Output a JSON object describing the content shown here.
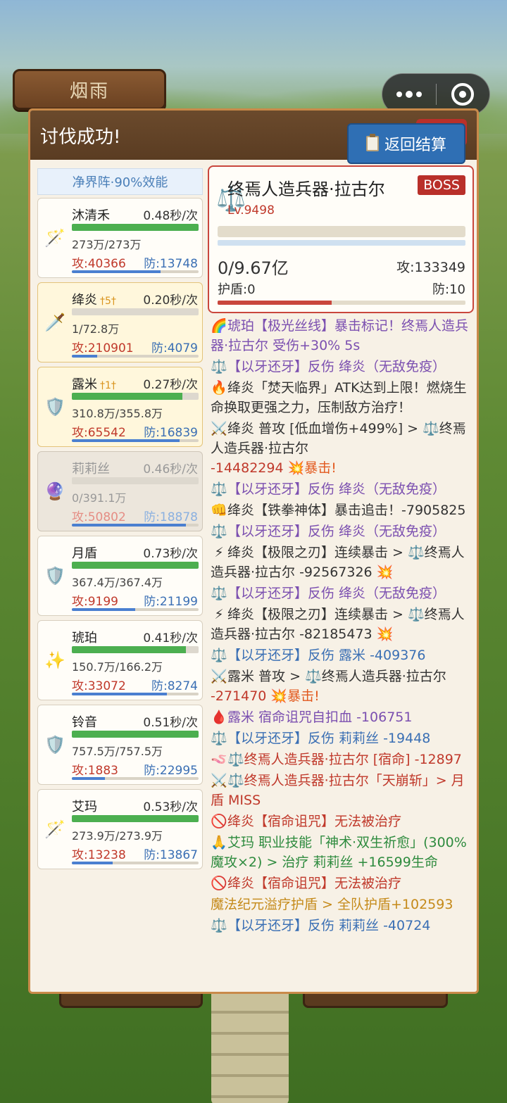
{
  "background": {
    "guild_label": "烟雨"
  },
  "capsule": {
    "more_icon": "more-dots-icon",
    "close_icon": "target-close-icon"
  },
  "panel": {
    "title": "讨伐成功!",
    "return_button": "返回结算",
    "formation": "净界阵·90%效能"
  },
  "heroes": [
    {
      "name": "沐清禾",
      "stars": "",
      "speed": "0.48秒/次",
      "hp": "273万/273万",
      "hp_fraction": 1.0,
      "atk": "攻:40366",
      "def": "防:13748",
      "def_fraction": 0.7,
      "icon": "staff-icon",
      "state": "normal"
    },
    {
      "name": "绛炎",
      "stars": "†5†",
      "speed": "0.20秒/次",
      "hp": "1/72.8万",
      "hp_fraction": 0.0,
      "atk": "攻:210901",
      "def": "防:4079",
      "def_fraction": 0.2,
      "icon": "sword-icon",
      "state": "active"
    },
    {
      "name": "露米",
      "stars": "†1†",
      "speed": "0.27秒/次",
      "hp": "310.8万/355.8万",
      "hp_fraction": 0.87,
      "atk": "攻:65542",
      "def": "防:16839",
      "def_fraction": 0.85,
      "icon": "shield-icon",
      "state": "active"
    },
    {
      "name": "莉莉丝",
      "stars": "",
      "speed": "0.46秒/次",
      "hp": "0/391.1万",
      "hp_fraction": 0.0,
      "atk": "攻:50802",
      "def": "防:18878",
      "def_fraction": 0.9,
      "icon": "orb-icon",
      "state": "dead"
    },
    {
      "name": "月盾",
      "stars": "",
      "speed": "0.73秒/次",
      "hp": "367.4万/367.4万",
      "hp_fraction": 1.0,
      "atk": "攻:9199",
      "def": "防:21199",
      "def_fraction": 0.5,
      "icon": "shield-icon",
      "state": "normal"
    },
    {
      "name": "琥珀",
      "stars": "",
      "speed": "0.41秒/次",
      "hp": "150.7万/166.2万",
      "hp_fraction": 0.9,
      "atk": "攻:33072",
      "def": "防:8274",
      "def_fraction": 0.75,
      "icon": "wand-icon",
      "state": "normal"
    },
    {
      "name": "铃音",
      "stars": "",
      "speed": "0.51秒/次",
      "hp": "757.5万/757.5万",
      "hp_fraction": 1.0,
      "atk": "攻:1883",
      "def": "防:22995",
      "def_fraction": 0.26,
      "icon": "shield-icon",
      "state": "normal"
    },
    {
      "name": "艾玛",
      "stars": "",
      "speed": "0.53秒/次",
      "hp": "273.9万/273.9万",
      "hp_fraction": 1.0,
      "atk": "攻:13238",
      "def": "防:13867",
      "def_fraction": 0.32,
      "icon": "staff-icon",
      "state": "normal"
    }
  ],
  "boss": {
    "name": "终焉人造兵器·拉古尔",
    "badge": "BOSS",
    "level": "Lv.9498",
    "hp": "0/9.67亿",
    "atk": "攻:133349",
    "shield": "护盾:0",
    "def": "防:10"
  },
  "log": [
    {
      "icon": "🌈",
      "color": "c-purple",
      "text": "琥珀【极光丝线】暴击标记！终焉人造兵器·拉古尔 受伤+30% 5s"
    },
    {
      "icon": "⚖️",
      "color": "c-purple",
      "text": "【以牙还牙】反伤 绛炎（无敌免疫）"
    },
    {
      "icon": "🔥",
      "color": "c-gray",
      "text": "绛炎「焚天临界」ATK达到上限！燃烧生命换取更强之力，压制敌方治疗！"
    },
    {
      "icon": "⚔️",
      "color": "c-gray",
      "text": "绛炎 普攻 [低血增伤+499%] > ⚖️终焉人造兵器·拉古尔",
      "dmg": "-14482294",
      "crit": "💥暴击!"
    },
    {
      "icon": "⚖️",
      "color": "c-purple",
      "text": "【以牙还牙】反伤 绛炎（无敌免疫）"
    },
    {
      "icon": "👊",
      "color": "c-gray",
      "text": "绛炎【铁拳神体】暴击追击！-7905825"
    },
    {
      "icon": "⚖️",
      "color": "c-purple",
      "text": "【以牙还牙】反伤 绛炎（无敌免疫）"
    },
    {
      "icon": "⚡",
      "color": "c-gray",
      "text": "绛炎【极限之刃】连续暴击 > ⚖️终焉人造兵器·拉古尔 -92567326 💥"
    },
    {
      "icon": "⚖️",
      "color": "c-purple",
      "text": "【以牙还牙】反伤 绛炎（无敌免疫）"
    },
    {
      "icon": "⚡",
      "color": "c-gray",
      "text": "绛炎【极限之刃】连续暴击 > ⚖️终焉人造兵器·拉古尔 -82185473 💥"
    },
    {
      "icon": "⚖️",
      "color": "c-blue",
      "text": "【以牙还牙】反伤 露米 -409376"
    },
    {
      "icon": "⚔️",
      "color": "c-gray",
      "text": "露米 普攻 > ⚖️终焉人造兵器·拉古尔",
      "dmg": "-271470",
      "crit": "💥暴击!"
    },
    {
      "icon": "🩸",
      "color": "c-purple",
      "text": "露米 宿命诅咒自扣血 -106751"
    },
    {
      "icon": "⚖️",
      "color": "c-blue",
      "text": "【以牙还牙】反伤 莉莉丝 -19448"
    },
    {
      "icon": "🪱",
      "color": "c-red",
      "text": "⚖️终焉人造兵器·拉古尔 [宿命] -12897"
    },
    {
      "icon": "⚔️",
      "color": "c-red",
      "text": "⚖️终焉人造兵器·拉古尔「天崩斩」> 月盾 MISS"
    },
    {
      "icon": "🚫",
      "color": "c-red",
      "text": "绛炎【宿命诅咒】无法被治疗"
    },
    {
      "icon": "🙏",
      "color": "c-green",
      "text": "艾玛 职业技能「神术·双生祈愈」(300%魔攻×2) > 治疗 莉莉丝 +16599生命"
    },
    {
      "icon": "🚫",
      "color": "c-red",
      "text": "绛炎【宿命诅咒】无法被治疗"
    },
    {
      "icon": "",
      "color": "c-orange",
      "text": "魔法纪元溢疗护盾 > 全队护盾+102593"
    },
    {
      "icon": "⚖️",
      "color": "c-blue",
      "text": "【以牙还牙】反伤 莉莉丝 -40724"
    }
  ]
}
